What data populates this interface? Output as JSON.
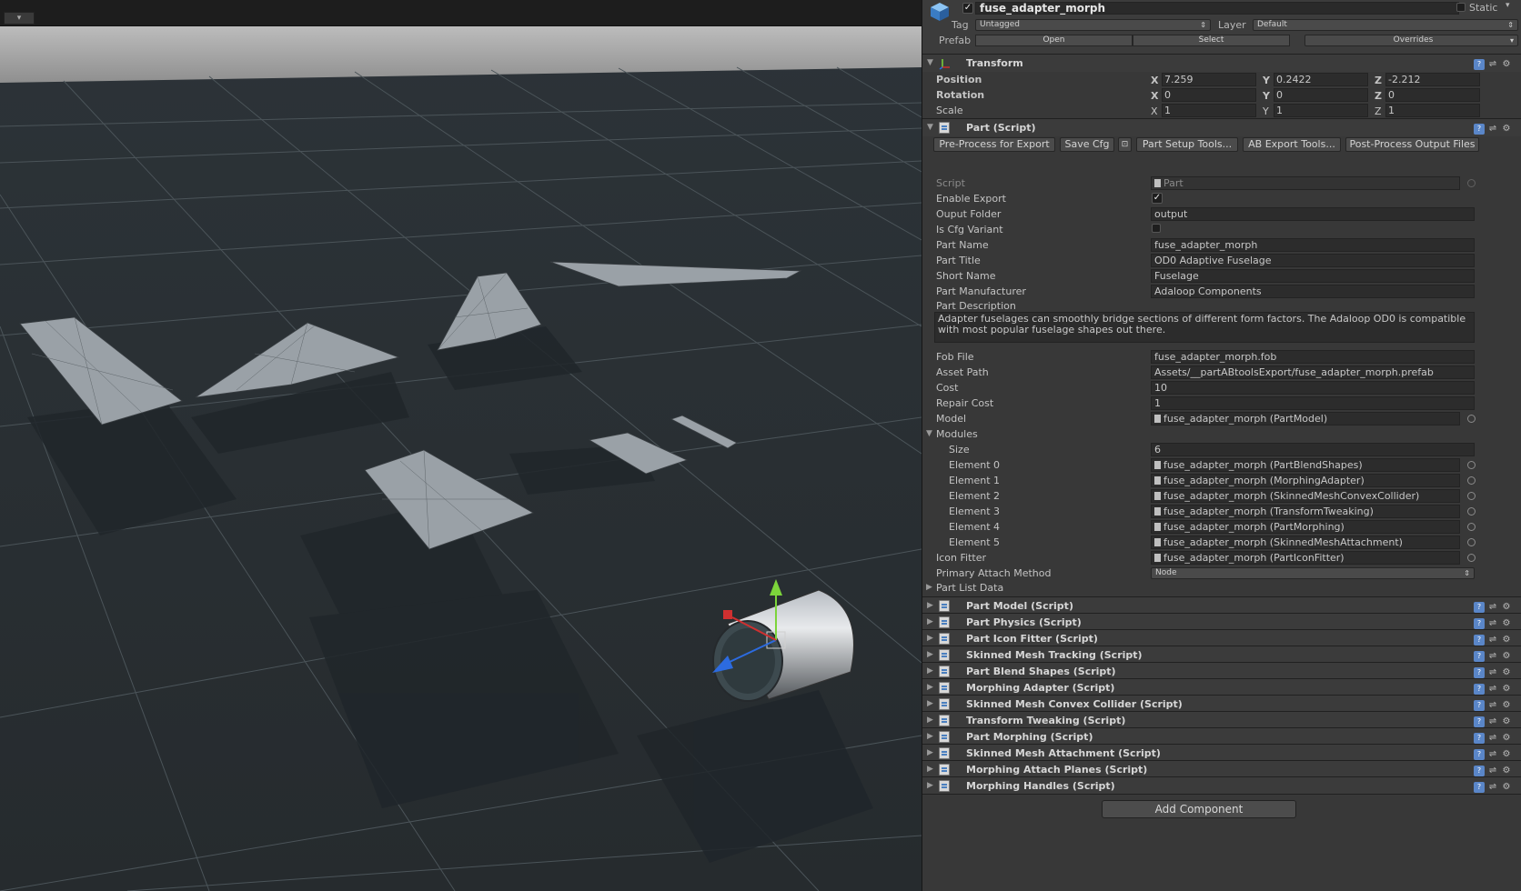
{
  "scene": {
    "toolbar_button": "▾"
  },
  "inspector": {
    "object_name": "fuse_adapter_morph",
    "static_label": "Static",
    "tag_label": "Tag",
    "tag_value": "Untagged",
    "layer_label": "Layer",
    "layer_value": "Default",
    "prefab_label": "Prefab",
    "prefab_open": "Open",
    "prefab_select": "Select",
    "prefab_overrides": "Overrides",
    "transform": {
      "title": "Transform",
      "position_label": "Position",
      "rotation_label": "Rotation",
      "scale_label": "Scale",
      "axis_x": "X",
      "axis_y": "Y",
      "axis_z": "Z",
      "position": {
        "x": "7.259",
        "y": "0.2422",
        "z": "-2.212"
      },
      "rotation": {
        "x": "0",
        "y": "0",
        "z": "0"
      },
      "scale": {
        "x": "1",
        "y": "1",
        "z": "1"
      }
    },
    "part_script": {
      "title": "Part (Script)",
      "buttons": [
        "Pre-Process for Export",
        "Save Cfg",
        "⊡",
        "Part Setup Tools...",
        "AB Export Tools...",
        "Post-Process Output Files"
      ],
      "script_label": "Script",
      "script_value": "Part",
      "enable_export_label": "Enable Export",
      "ouput_folder_label": "Ouput Folder",
      "ouput_folder_value": "output",
      "is_cfg_variant_label": "Is Cfg Variant",
      "part_name_label": "Part Name",
      "part_name_value": "fuse_adapter_morph",
      "part_title_label": "Part Title",
      "part_title_value": "OD0 Adaptive Fuselage",
      "short_name_label": "Short Name",
      "short_name_value": "Fuselage",
      "part_manufacturer_label": "Part Manufacturer",
      "part_manufacturer_value": "Adaloop Components",
      "part_description_label": "Part Description",
      "part_description_value": "Adapter fuselages can smoothly bridge sections of different form factors. The Adaloop OD0 is compatible with most popular fuselage shapes out there.",
      "fob_file_label": "Fob File",
      "fob_file_value": "fuse_adapter_morph.fob",
      "asset_path_label": "Asset Path",
      "asset_path_value": "Assets/__partABtoolsExport/fuse_adapter_morph.prefab",
      "cost_label": "Cost",
      "cost_value": "10",
      "repair_cost_label": "Repair Cost",
      "repair_cost_value": "1",
      "model_label": "Model",
      "model_value": "fuse_adapter_morph (PartModel)",
      "modules_label": "Modules",
      "size_label": "Size",
      "size_value": "6",
      "elements": [
        {
          "label": "Element 0",
          "value": "fuse_adapter_morph (PartBlendShapes)"
        },
        {
          "label": "Element 1",
          "value": "fuse_adapter_morph (MorphingAdapter)"
        },
        {
          "label": "Element 2",
          "value": "fuse_adapter_morph (SkinnedMeshConvexCollider)"
        },
        {
          "label": "Element 3",
          "value": "fuse_adapter_morph (TransformTweaking)"
        },
        {
          "label": "Element 4",
          "value": "fuse_adapter_morph (PartMorphing)"
        },
        {
          "label": "Element 5",
          "value": "fuse_adapter_morph (SkinnedMeshAttachment)"
        }
      ],
      "icon_fitter_label": "Icon Fitter",
      "icon_fitter_value": "fuse_adapter_morph (PartIconFitter)",
      "primary_attach_label": "Primary Attach Method",
      "primary_attach_value": "Node",
      "part_list_data_label": "Part List Data"
    },
    "components": [
      "Part Model (Script)",
      "Part Physics (Script)",
      "Part Icon Fitter (Script)",
      "Skinned Mesh Tracking (Script)",
      "Part Blend Shapes (Script)",
      "Morphing Adapter (Script)",
      "Skinned Mesh Convex Collider (Script)",
      "Transform Tweaking (Script)",
      "Part Morphing (Script)",
      "Skinned Mesh Attachment (Script)",
      "Morphing Attach Planes (Script)",
      "Morphing Handles (Script)"
    ],
    "add_component": "Add Component"
  }
}
